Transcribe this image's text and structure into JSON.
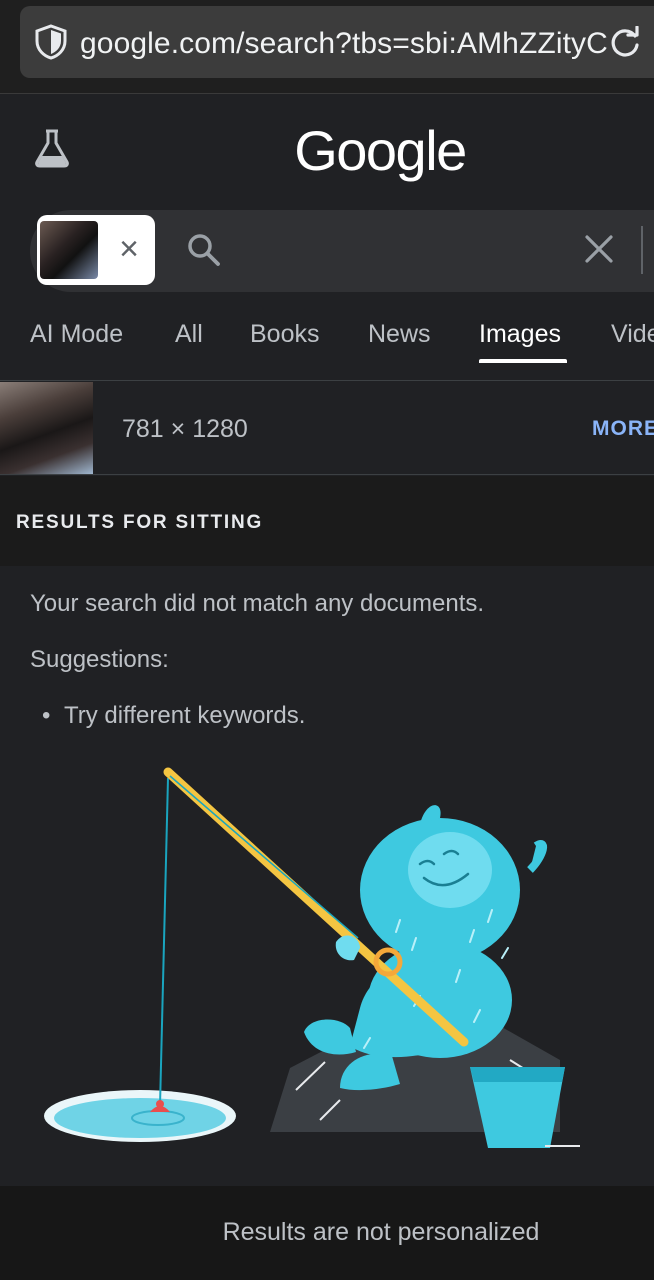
{
  "browser": {
    "url": "google.com/search?tbs=sbi:AMhZZityC",
    "shield_icon": "shield-icon",
    "reload_icon": "reload-icon"
  },
  "header": {
    "logo": "Google",
    "lab_icon": "flask-icon"
  },
  "search": {
    "placeholder": "",
    "value": "",
    "chip_close": "×"
  },
  "tabs": [
    {
      "label": "AI Mode",
      "active": false
    },
    {
      "label": "All",
      "active": false
    },
    {
      "label": "Books",
      "active": false
    },
    {
      "label": "News",
      "active": false
    },
    {
      "label": "Images",
      "active": true
    },
    {
      "label": "Vide",
      "active": false
    }
  ],
  "image_info": {
    "dimensions": "781 × 1280",
    "more_label": "MORE"
  },
  "results": {
    "title": "RESULTS FOR SITTING"
  },
  "message": {
    "main": "Your search did not match any documents.",
    "suggestions_label": "Suggestions:",
    "bullet": "•",
    "suggestion_1": "Try different keywords."
  },
  "footer": {
    "text": "Results are not personalized"
  },
  "colors": {
    "background": "#202124",
    "accent_link": "#8ab4f8",
    "illustration_cyan": "#3ec9e0",
    "rod_yellow": "#f4c542"
  }
}
